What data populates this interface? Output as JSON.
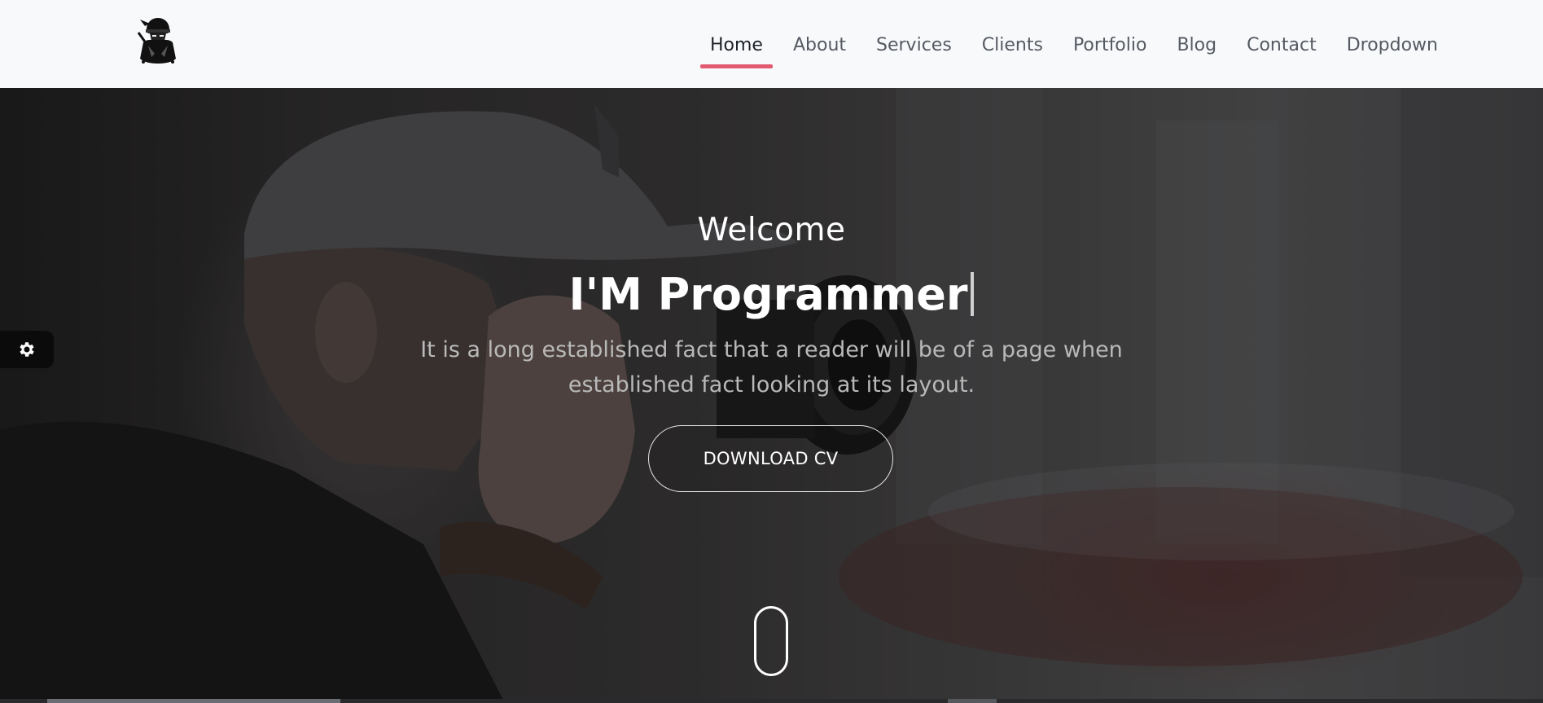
{
  "nav": {
    "items": [
      {
        "label": "Home",
        "active": true
      },
      {
        "label": "About"
      },
      {
        "label": "Services"
      },
      {
        "label": "Clients"
      },
      {
        "label": "Portfolio"
      },
      {
        "label": "Blog"
      },
      {
        "label": "Contact"
      },
      {
        "label": "Dropdown"
      }
    ],
    "active_color": "#e15a6f"
  },
  "logo": {
    "icon": "ninja-logo-icon"
  },
  "hero": {
    "welcome": "Welcome",
    "headline": "I'M Programmer",
    "description": "It is a long established fact that a reader will be of a page when established fact looking at its layout.",
    "cta_label": "DOWNLOAD CV",
    "scroll_icon": "mouse-scroll-icon"
  },
  "settings": {
    "icon": "gear-icon"
  }
}
